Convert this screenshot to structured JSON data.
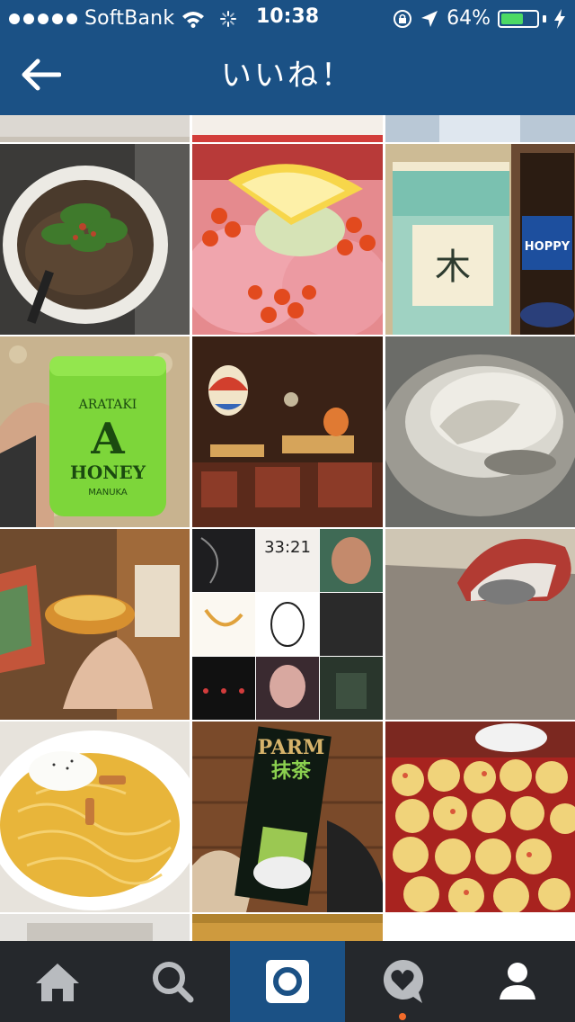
{
  "status_bar": {
    "carrier": "SoftBank",
    "time": "10:38",
    "battery_percent": "64%",
    "battery_level": 0.64,
    "icons": [
      "signal-dots-icon",
      "wifi-icon",
      "activity-spinner-icon",
      "rotation-lock-icon",
      "location-arrow-icon",
      "battery-icon",
      "charging-bolt-icon"
    ]
  },
  "nav": {
    "title": "いいね！",
    "back_icon": "back-arrow-icon"
  },
  "grid": {
    "tiles": [
      {
        "name": "noodle-soup-bowl",
        "caption": ""
      },
      {
        "name": "salmon-roe-lemon",
        "caption": ""
      },
      {
        "name": "hoppy-drink-glass",
        "caption": ""
      },
      {
        "name": "arataki-honey-jar",
        "caption": "ARATAKI HONEY MANUKA"
      },
      {
        "name": "lantern-bar-interior",
        "caption": ""
      },
      {
        "name": "raw-oyster",
        "caption": ""
      },
      {
        "name": "cheese-tart-hand",
        "caption": ""
      },
      {
        "name": "album-collage",
        "caption": "33:21"
      },
      {
        "name": "sock-on-carpet",
        "caption": ""
      },
      {
        "name": "carbonara-pasta",
        "caption": ""
      },
      {
        "name": "parm-matcha-icecream",
        "caption": "PARM The 抹茶"
      },
      {
        "name": "takoyaki-griddle",
        "caption": ""
      }
    ]
  },
  "tabbar": {
    "tabs": [
      {
        "name": "home",
        "icon": "home-icon",
        "active": false
      },
      {
        "name": "search",
        "icon": "search-icon",
        "active": false
      },
      {
        "name": "camera",
        "icon": "camera-icon",
        "active": true
      },
      {
        "name": "activity",
        "icon": "activity-heart-icon",
        "active": false,
        "has_notification": true
      },
      {
        "name": "profile",
        "icon": "profile-icon",
        "active": false
      }
    ]
  },
  "colors": {
    "header_bg": "#1b5185",
    "tabbar_bg": "#25282c",
    "active_tab_bg": "#1b5185",
    "battery_fill": "#4cd964",
    "notification": "#f26b2a"
  }
}
